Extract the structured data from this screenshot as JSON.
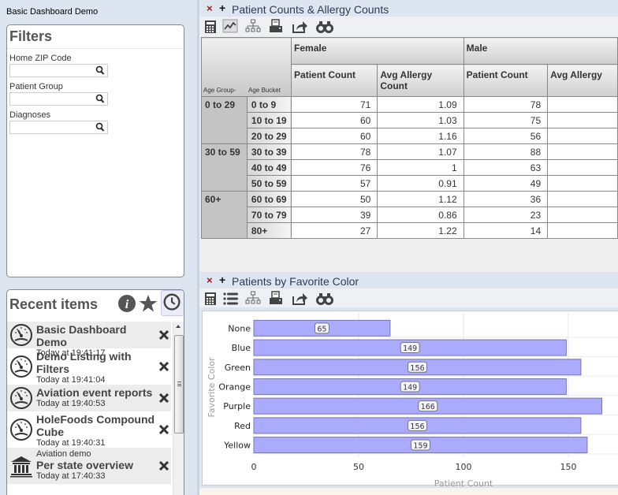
{
  "app": {
    "title": "Basic Dashboard Demo"
  },
  "filters": {
    "title": "Filters",
    "fields": [
      {
        "label": "Home ZIP Code",
        "value": "",
        "placeholder": ""
      },
      {
        "label": "Patient Group",
        "value": "",
        "placeholder": ""
      },
      {
        "label": "Diagnoses",
        "value": "",
        "placeholder": ""
      }
    ]
  },
  "recent": {
    "title": "Recent items",
    "header_icons": [
      "info-icon",
      "star-icon",
      "clock-icon"
    ],
    "items": [
      {
        "icon": "dashboard-gauge-icon",
        "subtitle": "",
        "name": "Basic Dashboard Demo",
        "time": "Today at 19:41:17"
      },
      {
        "icon": "dashboard-gauge-icon",
        "subtitle": "",
        "name": "Demo Listing with Filters",
        "time": "Today at 19:41:04"
      },
      {
        "icon": "dashboard-gauge-icon",
        "subtitle": "",
        "name": "Aviation event reports",
        "time": "Today at 19:40:53"
      },
      {
        "icon": "dashboard-gauge-icon",
        "subtitle": "",
        "name": "HoleFoods Compound Cube",
        "time": "Today at 19:40:31"
      },
      {
        "icon": "bank-building-icon",
        "subtitle": "Aviation demo",
        "name": "Per state overview",
        "time": "Today at 17:40:33"
      }
    ]
  },
  "pivot_panel": {
    "title": "Patient Counts & Allergy Counts",
    "close_glyph": "×",
    "add_glyph": "+",
    "toolbar": [
      "calculator-icon",
      "line-chart-icon",
      "hierarchy-icon",
      "print-icon",
      "export-icon",
      "binoculars-icon"
    ],
    "row_axis_labels": [
      "Age Group-",
      "Age Bucket"
    ],
    "column_groups": [
      "Female",
      "Male"
    ],
    "measures": [
      "Patient Count",
      "Avg Allergy Count",
      "Patient Count",
      "Avg Allergy"
    ],
    "groups": [
      {
        "label": "0 to 29",
        "rows": [
          {
            "bucket": "0 to 9",
            "values": [
              "71",
              "1.09",
              "78",
              ""
            ]
          },
          {
            "bucket": "10 to 19",
            "values": [
              "60",
              "1.03",
              "75",
              ""
            ]
          },
          {
            "bucket": "20 to 29",
            "values": [
              "60",
              "1.16",
              "56",
              ""
            ]
          }
        ]
      },
      {
        "label": "30 to 59",
        "rows": [
          {
            "bucket": "30 to 39",
            "values": [
              "78",
              "1.07",
              "88",
              ""
            ]
          },
          {
            "bucket": "40 to 49",
            "values": [
              "76",
              "1",
              "63",
              ""
            ]
          },
          {
            "bucket": "50 to 59",
            "values": [
              "57",
              "0.91",
              "49",
              ""
            ]
          }
        ]
      },
      {
        "label": "60+",
        "rows": [
          {
            "bucket": "60 to 69",
            "values": [
              "50",
              "1.12",
              "36",
              ""
            ]
          },
          {
            "bucket": "70 to 79",
            "values": [
              "39",
              "0.86",
              "23",
              ""
            ]
          },
          {
            "bucket": "80+",
            "values": [
              "27",
              "1.22",
              "14",
              ""
            ]
          }
        ]
      }
    ]
  },
  "chart_panel": {
    "title": "Patients by Favorite Color",
    "close_glyph": "×",
    "add_glyph": "+",
    "toolbar": [
      "calculator-icon",
      "list-icon",
      "hierarchy-icon",
      "print-icon",
      "export-icon",
      "binoculars-icon"
    ]
  },
  "chart_data": {
    "type": "bar",
    "orientation": "horizontal",
    "title": "",
    "categories": [
      "None",
      "Blue",
      "Green",
      "Orange",
      "Purple",
      "Red",
      "Yellow"
    ],
    "values": [
      65,
      149,
      156,
      149,
      166,
      156,
      159
    ],
    "xlabel": "Patient Count",
    "ylabel": "Favorite Color",
    "xlim": [
      0,
      175
    ],
    "xticks": [
      0,
      50,
      100,
      150
    ],
    "grid": true,
    "data_labels": true,
    "bar_color": "#aaaaff",
    "bar_border": "#7777aa"
  }
}
